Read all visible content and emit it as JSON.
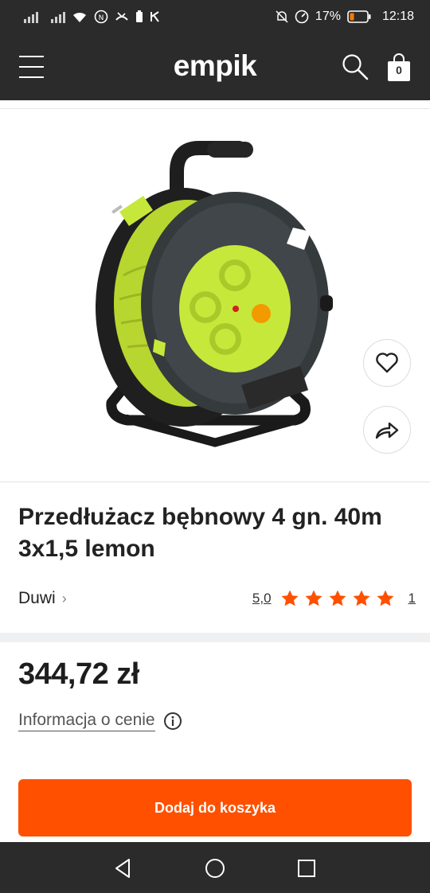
{
  "status_bar": {
    "time": "12:18",
    "battery": "17%",
    "left_icons": [
      "signal-icon",
      "signal-icon",
      "wifi-icon",
      "nfc-icon",
      "missed-call-icon",
      "battery-saver-icon",
      "app-icon"
    ],
    "right_icons": [
      "mute-icon",
      "speed-icon",
      "battery-icon"
    ]
  },
  "header": {
    "logo": "empik",
    "cart_count": "0",
    "icons": [
      "menu-icon",
      "search-icon",
      "cart-icon"
    ]
  },
  "product": {
    "title": "Przedłużacz bębnowy 4 gn. 40m 3x1,5 lemon",
    "brand": "Duwi",
    "brand_chevron": "›",
    "rating": "5,0",
    "stars": 5,
    "reviews": "1",
    "price": "344,72 zł",
    "price_info": "Informacja o cenie",
    "add_to_cart": "Dodaj do koszyka"
  },
  "colors": {
    "header_bg": "#2b2b2b",
    "accent": "#ff5000",
    "star": "#ff5000",
    "product_lime": "#c6e83a"
  },
  "nav": [
    "back-icon",
    "home-icon",
    "recents-icon"
  ]
}
